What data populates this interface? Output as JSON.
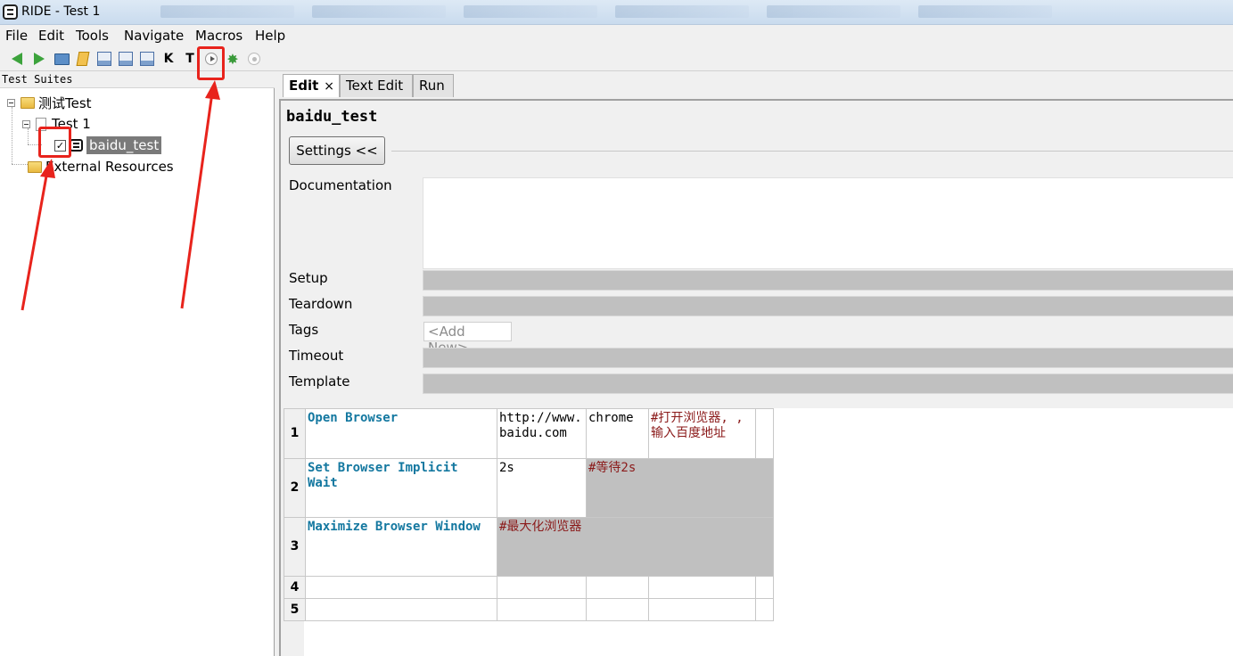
{
  "window": {
    "title": "RIDE - Test 1"
  },
  "menu": [
    "File",
    "Edit",
    "Tools",
    "Navigate",
    "Macros",
    "Help"
  ],
  "toolbar": {
    "icons": [
      "arrow-left-icon",
      "arrow-right-icon",
      "folder-icon",
      "open-icon",
      "save-icon",
      "save-all-icon",
      "save-as-icon",
      "k-letter-icon",
      "t-letter-icon",
      "run-icon",
      "debug-icon",
      "stop-icon"
    ],
    "k_label": "K",
    "t_label": "T"
  },
  "tree": {
    "header": "Test Suites",
    "root": "测试Test",
    "child": "Test 1",
    "test_case": "baidu_test",
    "external": "External Resources",
    "checked": true
  },
  "tabs": [
    "Edit",
    "Text Edit",
    "Run"
  ],
  "tab_close": "×",
  "editor": {
    "name": "baidu_test",
    "settings_button": "Settings <<",
    "labels": {
      "documentation": "Documentation",
      "setup": "Setup",
      "teardown": "Teardown",
      "tags": "Tags",
      "timeout": "Timeout",
      "template": "Template"
    },
    "tags_add": "<Add New>"
  },
  "grid": {
    "rows": [
      {
        "num": "1",
        "keyword": "Open Browser",
        "arg1": "http://www.baidu.com",
        "arg2": "chrome",
        "comment": "#打开浏览器, , 输入百度地址"
      },
      {
        "num": "2",
        "keyword": "Set Browser Implicit Wait",
        "arg1": "2s",
        "arg2": "#等待2s",
        "comment": ""
      },
      {
        "num": "3",
        "keyword": "Maximize Browser Window",
        "arg1": "#最大化浏览器",
        "arg2": "",
        "comment": ""
      },
      {
        "num": "4",
        "keyword": "",
        "arg1": "",
        "arg2": "",
        "comment": ""
      },
      {
        "num": "5",
        "keyword": "",
        "arg1": "",
        "arg2": "",
        "comment": ""
      }
    ]
  },
  "colors": {
    "annotation": "#e8231c",
    "keyword": "#1478a0",
    "comment": "#8b1a1a",
    "selection": "#7a7a7a"
  }
}
